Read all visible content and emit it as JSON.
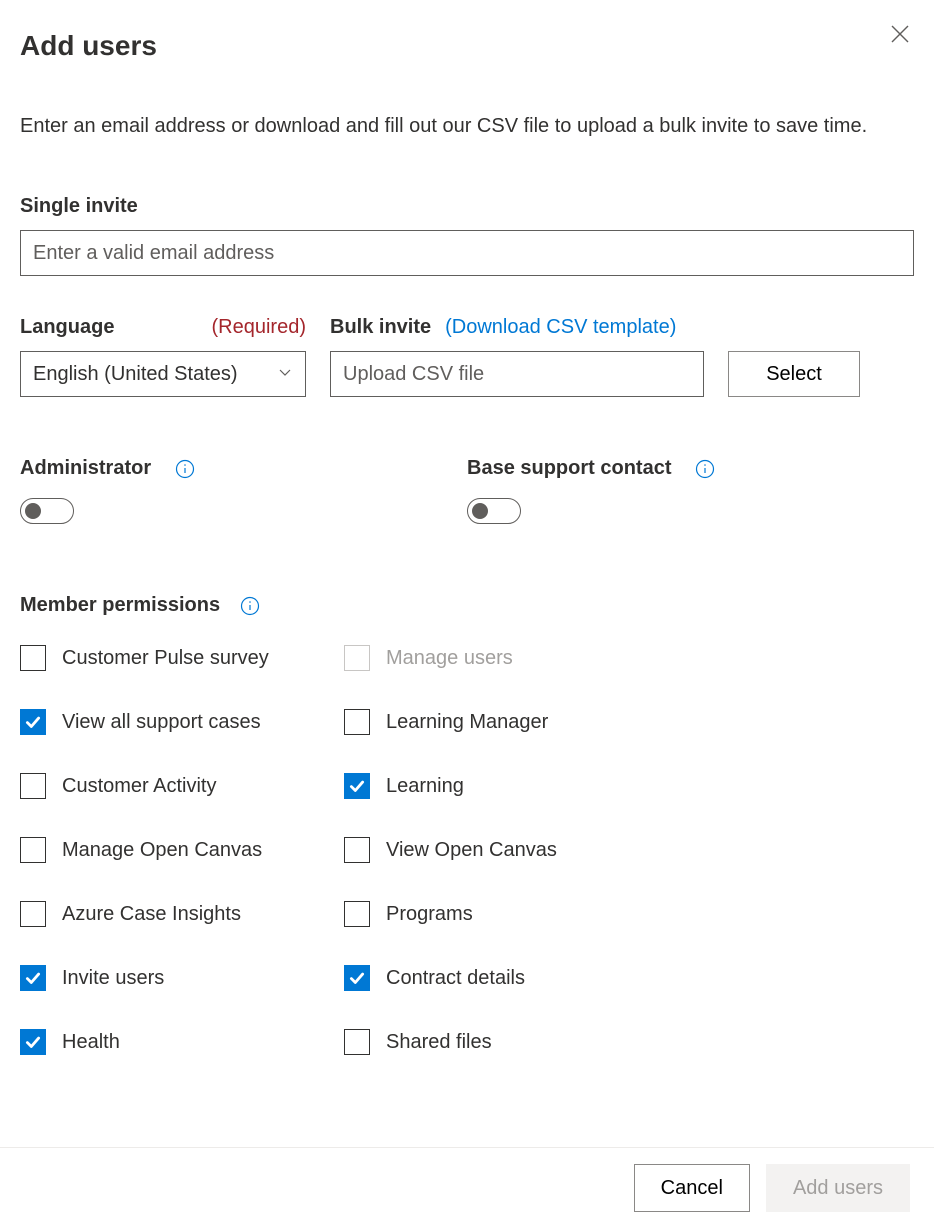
{
  "title": "Add users",
  "intro": "Enter an email address or download and fill out our CSV file to upload a bulk invite to save time.",
  "single": {
    "label": "Single invite",
    "placeholder": "Enter a valid email address"
  },
  "language": {
    "label": "Language",
    "required": "(Required)",
    "value": "English (United States)"
  },
  "bulk": {
    "label": "Bulk invite",
    "download_link": "(Download CSV template)",
    "upload_placeholder": "Upload CSV file",
    "select_btn": "Select"
  },
  "toggles": {
    "admin_label": "Administrator",
    "base_label": "Base support contact",
    "admin_on": false,
    "base_on": false
  },
  "permissions": {
    "label": "Member permissions",
    "items": [
      {
        "label": "Customer Pulse survey",
        "checked": false,
        "disabled": false
      },
      {
        "label": "Manage users",
        "checked": false,
        "disabled": true
      },
      {
        "label": "View all support cases",
        "checked": true,
        "disabled": false
      },
      {
        "label": "Learning Manager",
        "checked": false,
        "disabled": false
      },
      {
        "label": "Customer Activity",
        "checked": false,
        "disabled": false
      },
      {
        "label": "Learning",
        "checked": true,
        "disabled": false
      },
      {
        "label": "Manage Open Canvas",
        "checked": false,
        "disabled": false
      },
      {
        "label": "View Open Canvas",
        "checked": false,
        "disabled": false
      },
      {
        "label": "Azure Case Insights",
        "checked": false,
        "disabled": false
      },
      {
        "label": "Programs",
        "checked": false,
        "disabled": false
      },
      {
        "label": "Invite users",
        "checked": true,
        "disabled": false
      },
      {
        "label": "Contract details",
        "checked": true,
        "disabled": false
      },
      {
        "label": "Health",
        "checked": true,
        "disabled": false
      },
      {
        "label": "Shared files",
        "checked": false,
        "disabled": false
      }
    ]
  },
  "footer": {
    "cancel": "Cancel",
    "add": "Add users"
  }
}
